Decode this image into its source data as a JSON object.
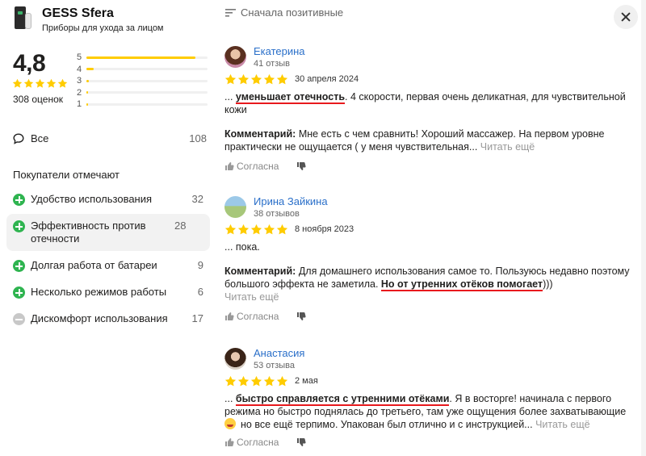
{
  "product": {
    "name": "GESS Sfera",
    "category": "Приборы для ухода за лицом"
  },
  "rating": {
    "value": "4,8",
    "count_label": "308 оценок",
    "stars": 5,
    "distribution": [
      {
        "label": "5",
        "fraction": 0.9
      },
      {
        "label": "4",
        "fraction": 0.06
      },
      {
        "label": "3",
        "fraction": 0.02
      },
      {
        "label": "2",
        "fraction": 0.01
      },
      {
        "label": "1",
        "fraction": 0.01
      }
    ],
    "star_color": "#ffcc00"
  },
  "filter_all": {
    "label": "Все",
    "count": "108"
  },
  "notes_title": "Покупатели отмечают",
  "tags": [
    {
      "label": "Удобство использования",
      "count": "32",
      "kind": "plus"
    },
    {
      "label": "Эффективность против отечности",
      "count": "28",
      "kind": "plus"
    },
    {
      "label": "Долгая работа от батареи",
      "count": "9",
      "kind": "plus"
    },
    {
      "label": "Несколько режимов работы",
      "count": "6",
      "kind": "plus"
    },
    {
      "label": "Дискомфорт использования",
      "count": "17",
      "kind": "minus"
    }
  ],
  "sort": {
    "label": "Сначала позитивные",
    "icon": "sort-icon"
  },
  "reviews": [
    {
      "name": "Екатерина",
      "reviews_count": "41 отзыв",
      "date": "30 апреля 2024",
      "text_prefix": "... ",
      "text_highlight": "уменьшает отечность",
      "text_rest": ". 4 скорости, первая очень деликатная, для чувствительной кожи",
      "comment_label": "Комментарий:",
      "comment_text": " Мне есть с чем сравнить! Хороший массажер. На первом уровне практически не ощущается ( у меня чувствительная...",
      "comment_highlight": "",
      "comment_after": "",
      "more": " Читать ещё",
      "agree": "Согласна"
    },
    {
      "name": "Ирина Зайкина",
      "reviews_count": "38 отзывов",
      "date": "8 ноября 2023",
      "text": "... пока.",
      "comment_label": "Комментарий:",
      "comment_text": " Для домашнего использования самое то. Пользуюсь недавно поэтому большого эффекта не заметила. ",
      "comment_highlight": "Но от утренних отёков помогает",
      "comment_after": ")))",
      "more": "Читать ещё",
      "agree": "Согласна"
    },
    {
      "name": "Анастасия",
      "reviews_count": "53 отзыва",
      "date": "2 мая",
      "text_prefix": "... ",
      "text_highlight": "быстро справляется с утренними отёками",
      "text_rest": ". Я в восторге! начинала с первого режима но быстро поднялась до третьего, там уже ощущения более захватывающие",
      "text_tail": "но все ещё терпимо. Упакован был отлично и с инструкцией...",
      "more": " Читать ещё",
      "agree": "Согласна"
    }
  ],
  "colors": {
    "link": "#2a6fc9",
    "highlight_underline": "#e8191d",
    "tag_plus": "#2fb450",
    "tag_minus": "#c8c8c8"
  }
}
